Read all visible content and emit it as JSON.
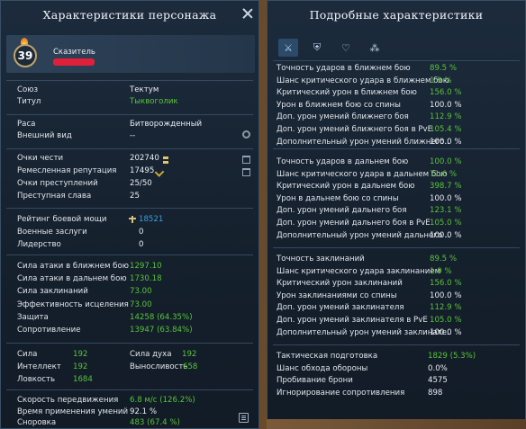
{
  "left": {
    "title": "Характеристики персонажа",
    "level": "39",
    "class_name": "Сказитель",
    "info": [
      {
        "label": "Союз",
        "value": "Тектум",
        "color": "white"
      },
      {
        "label": "Титул",
        "value": "Тыквоголик",
        "color": "green"
      }
    ],
    "appearance": [
      {
        "label": "Раса",
        "value": "Битворожденный"
      },
      {
        "label": "Внешний вид",
        "value": "--"
      }
    ],
    "honor": [
      {
        "label": "Очки чести",
        "value": "202740"
      },
      {
        "label": "Ремесленная репутация",
        "value": "17495"
      },
      {
        "label": "Очки преступлений",
        "value": "25/50"
      },
      {
        "label": "Преступная слава",
        "value": "25"
      }
    ],
    "combat": [
      {
        "label": "Рейтинг боевой мощи",
        "value": "18521"
      },
      {
        "label": "Военные заслуги",
        "value": "0"
      },
      {
        "label": "Лидерство",
        "value": "0"
      }
    ],
    "attack": [
      {
        "label": "Сила атаки в ближнем бою",
        "value": "1297.10"
      },
      {
        "label": "Сила атаки в дальнем бою",
        "value": "1730.18"
      },
      {
        "label": "Сила заклинаний",
        "value": "73.00"
      },
      {
        "label": "Эффективность исцеления",
        "value": "73.00"
      },
      {
        "label": "Защита",
        "value": "14258 (64.35%)"
      },
      {
        "label": "Сопротивление",
        "value": "13947 (63.84%)"
      }
    ],
    "attributes": [
      {
        "label": "Сила",
        "value": "192",
        "label2": "Сила духа",
        "value2": "192"
      },
      {
        "label": "Интеллект",
        "value": "192",
        "label2": "Выносливость",
        "value2": "658"
      },
      {
        "label": "Ловкость",
        "value": "1684"
      }
    ],
    "speed": [
      {
        "label": "Скорость передвижения",
        "value": "6.8 м/с (126.2%)",
        "color": "green"
      },
      {
        "label": "Время применения умений",
        "value": "92.1 %",
        "color": "white"
      },
      {
        "label": "Сноровка",
        "value": "483 (67.4 %)",
        "color": "green"
      }
    ]
  },
  "right": {
    "title": "Подробные характеристики",
    "tabs": [
      {
        "name": "tab-attack",
        "icon": "crossed-swords-icon",
        "glyph": "⚔"
      },
      {
        "name": "tab-defense",
        "icon": "shield-icon",
        "glyph": "⛨"
      },
      {
        "name": "tab-heal",
        "icon": "heart-plus-icon",
        "glyph": "♡"
      },
      {
        "name": "tab-misc",
        "icon": "group-icon",
        "glyph": "⁂"
      }
    ],
    "melee": [
      {
        "label": "Точность ударов в ближнем бою",
        "value": "89.5 %",
        "color": "green"
      },
      {
        "label": "Шанс критического удара в ближнем бою",
        "value": "1.9 %",
        "color": "green"
      },
      {
        "label": "Критический урон в ближнем бою",
        "value": "156.0 %",
        "color": "green"
      },
      {
        "label": "Урон в ближнем бою со спины",
        "value": "100.0 %",
        "color": "white"
      },
      {
        "label": "Доп. урон умений ближнего боя",
        "value": "112.9 %",
        "color": "green"
      },
      {
        "label": "Доп. урон умений ближнего боя в PvE",
        "value": "105.4 %",
        "color": "green"
      },
      {
        "label": "Дополнительный урон умений ближнего..",
        "value": "100.0 %",
        "color": "white"
      }
    ],
    "ranged": [
      {
        "label": "Точность ударов в дальнем бою",
        "value": "100.0 %",
        "color": "green"
      },
      {
        "label": "Шанс критического удара в дальнем бою",
        "value": "71.6 %",
        "color": "green"
      },
      {
        "label": "Критический урон в дальнем бою",
        "value": "398.7 %",
        "color": "green"
      },
      {
        "label": "Урон в дальнем бою со спины",
        "value": "100.0 %",
        "color": "white"
      },
      {
        "label": "Доп. урон умений дальнего боя",
        "value": "123.1 %",
        "color": "green"
      },
      {
        "label": "Доп. урон умений дальнего боя в PvE",
        "value": "105.0 %",
        "color": "green"
      },
      {
        "label": "Дополнительный урон умений дальнего ..",
        "value": "100.0 %",
        "color": "white"
      }
    ],
    "magic": [
      {
        "label": "Точность заклинаний",
        "value": "89.5 %",
        "color": "green"
      },
      {
        "label": "Шанс критического удара заклинанием",
        "value": "1.9 %",
        "color": "green"
      },
      {
        "label": "Критический урон заклинаний",
        "value": "156.0 %",
        "color": "green"
      },
      {
        "label": "Урон заклинаниями со спины",
        "value": "100.0 %",
        "color": "white"
      },
      {
        "label": "Доп. урон умений заклинателя",
        "value": "112.9 %",
        "color": "green"
      },
      {
        "label": "Доп. урон умений заклинателя в PvE",
        "value": "105.0 %",
        "color": "green"
      },
      {
        "label": "Дополнительный урон умений заклинате..",
        "value": "100.0 %",
        "color": "white"
      }
    ],
    "tactics": [
      {
        "label": "Тактическая подготовка",
        "value": "1829 (5.3%)",
        "color": "green"
      },
      {
        "label": "Шанс обхода обороны",
        "value": "0.0%",
        "color": "white"
      },
      {
        "label": "Пробивание брони",
        "value": "4575",
        "color": "white"
      },
      {
        "label": "Игнорирование сопротивления",
        "value": "898",
        "color": "white"
      }
    ]
  },
  "colors": {
    "green": "#57c33a",
    "blue": "#3e9be0",
    "panel": "#172433",
    "accent": "#bfa46b"
  }
}
